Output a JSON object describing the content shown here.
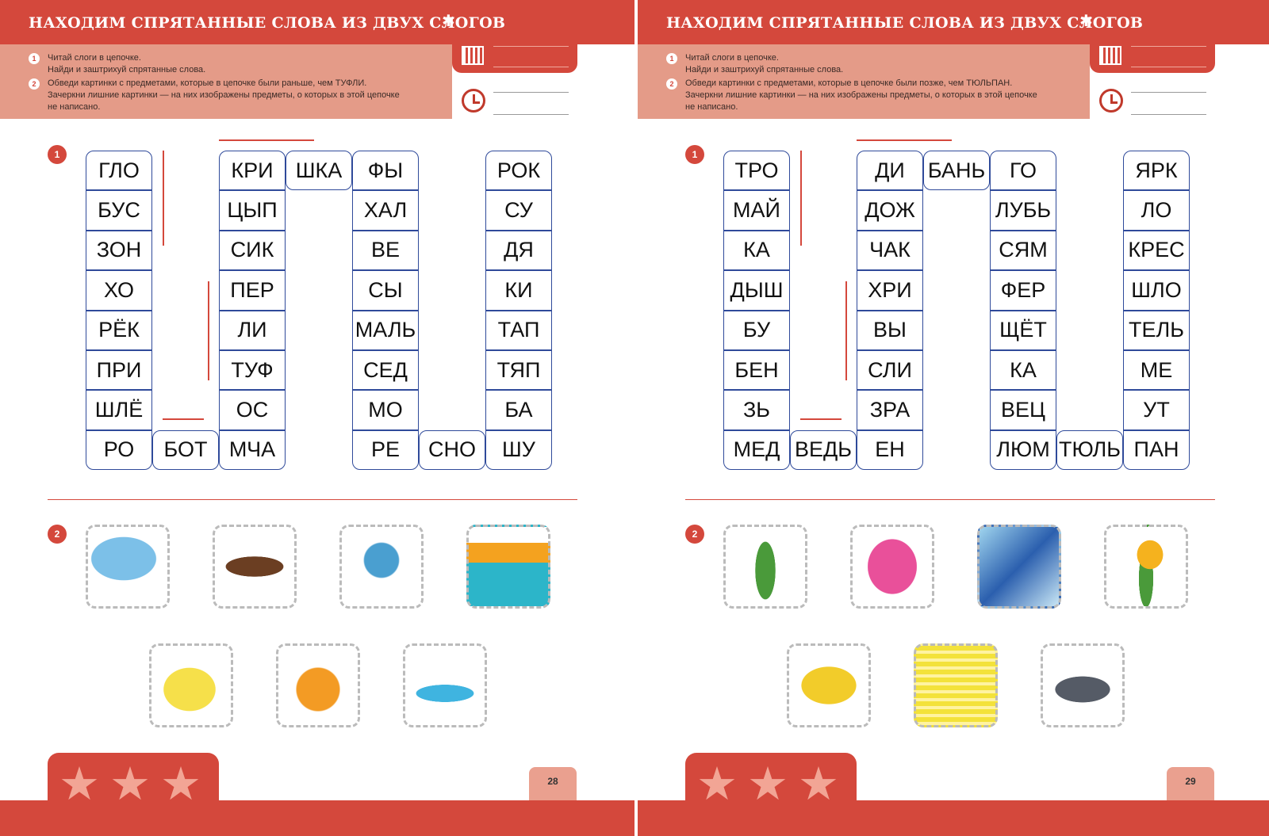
{
  "pages": [
    {
      "title": "НАХОДИМ СПРЯТАННЫЕ СЛОВА ИЗ ДВУХ СЛОГОВ",
      "instructions": [
        {
          "num": "1",
          "lines": [
            "Читай слоги в цепочке.",
            "Найди и заштрихуй спрятанные слова."
          ]
        },
        {
          "num": "2",
          "lines": [
            "Обведи картинки с предметами, которые в цепочке были раньше, чем ТУФЛИ.",
            "Зачеркни лишние картинки — на них изображены предметы, о которых в этой цепочке",
            "не написано."
          ]
        }
      ],
      "task1_num": "1",
      "task2_num": "2",
      "columns": [
        [
          "ГЛО",
          "БУС",
          "ЗОН",
          "ХО",
          "РЁК",
          "ПРИ",
          "ШЛЁ",
          "РО"
        ],
        [
          null,
          null,
          null,
          null,
          null,
          null,
          null,
          "БОТ"
        ],
        [
          "КРИ",
          "ЦЫП",
          "СИК",
          "ПЕР",
          "ЛИ",
          "ТУФ",
          "ОС",
          "МЧА"
        ],
        [
          "ШКА",
          null,
          null,
          null,
          null,
          null,
          null,
          null
        ],
        [
          "ФЫ",
          "ХАЛ",
          "ВЕ",
          "СЫ",
          "МАЛЬ",
          "СЕД",
          "МО",
          "РЕ"
        ],
        [
          null,
          null,
          null,
          null,
          null,
          null,
          null,
          "СНО"
        ],
        [
          "РОК",
          "СУ",
          "ДЯ",
          "КИ",
          "ТАП",
          "ТЯП",
          "БА",
          "ШУ"
        ]
      ],
      "pictures": [
        "umbrella",
        "otter",
        "globe",
        "sunset-sea",
        "chick",
        "peach",
        "shoes"
      ],
      "page_number": "28"
    },
    {
      "title": "НАХОДИМ СПРЯТАННЫЕ СЛОВА ИЗ ДВУХ СЛОГОВ",
      "instructions": [
        {
          "num": "1",
          "lines": [
            "Читай слоги в цепочке.",
            "Найди и заштрихуй спрятанные слова."
          ]
        },
        {
          "num": "2",
          "lines": [
            "Обведи картинки с предметами, которые в цепочке были позже, чем ТЮЛЬПАН.",
            "Зачеркни лишние картинки — на них изображены предметы, о которых в этой цепочке",
            "не написано."
          ]
        }
      ],
      "task1_num": "1",
      "task2_num": "2",
      "columns": [
        [
          "ТРО",
          "МАЙ",
          "КА",
          "ДЫШ",
          "БУ",
          "БЕН",
          "ЗЬ",
          "МЕД"
        ],
        [
          null,
          null,
          null,
          null,
          null,
          null,
          null,
          "ВЕДЬ"
        ],
        [
          "ДИ",
          "ДОЖ",
          "ЧАК",
          "ХРИ",
          "ВЫ",
          "СЛИ",
          "ЗРА",
          "ЕН"
        ],
        [
          "БАНЬ",
          null,
          null,
          null,
          null,
          null,
          null,
          null
        ],
        [
          "ГО",
          "ЛУБЬ",
          "СЯМ",
          "ФЕР",
          "ЩЁТ",
          "КА",
          "ВЕЦ",
          "ЛЮМ"
        ],
        [
          null,
          null,
          null,
          null,
          null,
          null,
          null,
          "ТЮЛЬ"
        ],
        [
          "ЯРК",
          "ЛО",
          "КРЕС",
          "ШЛО",
          "ТЕЛЬ",
          "МЕ",
          "УТ",
          "ПАН"
        ]
      ],
      "pictures": [
        "lily-of-the-valley",
        "armchair",
        "ornaments",
        "tulip",
        "tambourine",
        "dress",
        "pigeon"
      ],
      "page_number": "29"
    }
  ],
  "colors": {
    "accent": "#d4483c",
    "grid": "#2f4a9a",
    "instruction_bg": "#e49b88"
  }
}
